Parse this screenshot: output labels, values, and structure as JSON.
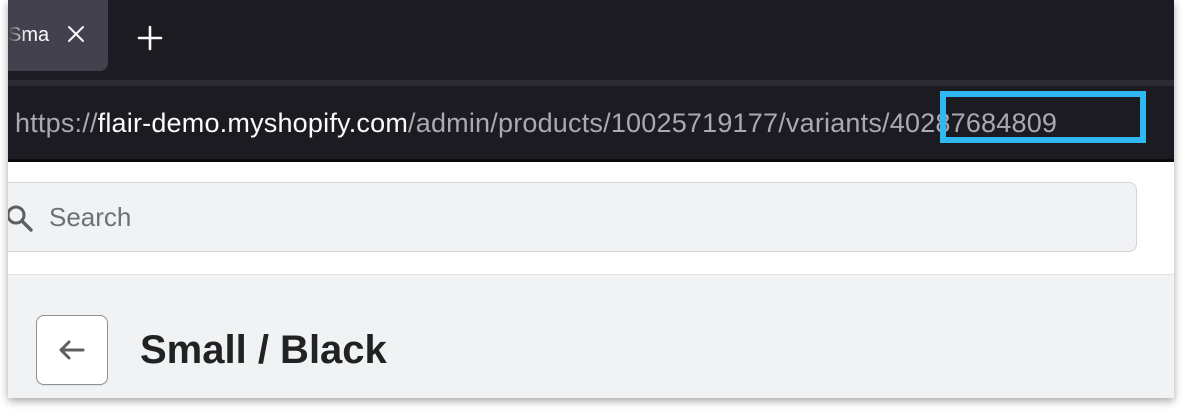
{
  "browser": {
    "tab": {
      "title": "Sma",
      "close_icon": "close-icon"
    },
    "new_tab_icon": "plus-icon",
    "url": {
      "scheme": "https://",
      "host": "flair-demo.myshopify.com",
      "path": "/admin/products/10025719177/variants/",
      "variant_id": "40287684809"
    },
    "highlight_color": "#2fb8f2"
  },
  "topbar": {
    "search": {
      "icon": "search-icon",
      "placeholder": "Search",
      "value": ""
    }
  },
  "page": {
    "back_icon": "arrow-left-icon",
    "title": "Small / Black"
  }
}
